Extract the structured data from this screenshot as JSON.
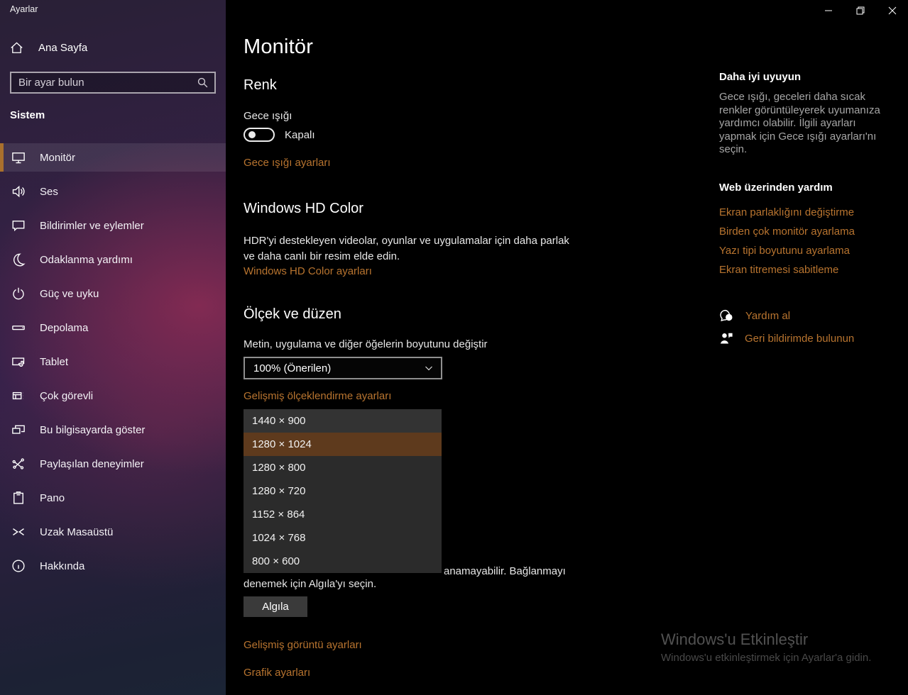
{
  "window": {
    "title": "Ayarlar",
    "controls": {
      "minimize": "minimize",
      "restore": "restore",
      "close": "close"
    }
  },
  "sidebar": {
    "home_label": "Ana Sayfa",
    "search_placeholder": "Bir ayar bulun",
    "section_label": "Sistem",
    "items": [
      {
        "icon": "monitor-icon",
        "label": "Monitör",
        "selected": true
      },
      {
        "icon": "speaker-icon",
        "label": "Ses",
        "selected": false
      },
      {
        "icon": "notifications-icon",
        "label": "Bildirimler ve eylemler",
        "selected": false
      },
      {
        "icon": "focus-moon-icon",
        "label": "Odaklanma yardımı",
        "selected": false
      },
      {
        "icon": "power-icon",
        "label": "Güç ve uyku",
        "selected": false
      },
      {
        "icon": "storage-icon",
        "label": "Depolama",
        "selected": false
      },
      {
        "icon": "tablet-icon",
        "label": "Tablet",
        "selected": false
      },
      {
        "icon": "multitask-icon",
        "label": "Çok görevli",
        "selected": false
      },
      {
        "icon": "project-icon",
        "label": "Bu bilgisayarda göster",
        "selected": false
      },
      {
        "icon": "shared-experiences-icon",
        "label": "Paylaşılan deneyimler",
        "selected": false
      },
      {
        "icon": "clipboard-icon",
        "label": "Pano",
        "selected": false
      },
      {
        "icon": "remote-desktop-icon",
        "label": "Uzak Masaüstü",
        "selected": false
      },
      {
        "icon": "info-icon",
        "label": "Hakkında",
        "selected": false
      }
    ]
  },
  "main": {
    "page_title": "Monitör",
    "color_section": {
      "heading": "Renk",
      "night_light_label": "Gece ışığı",
      "toggle_state": "Kapalı",
      "link": "Gece ışığı ayarları"
    },
    "hd_color_section": {
      "heading": "Windows HD Color",
      "description": "HDR'yi destekleyen videolar, oyunlar ve uygulamalar için daha parlak ve daha canlı bir resim elde edin.",
      "link": "Windows HD Color ayarları"
    },
    "scale_section": {
      "heading": "Ölçek ve düzen",
      "label": "Metin, uygulama ve diğer öğelerin boyutunu değiştir",
      "selected_value": "100% (Önerilen)",
      "link": "Gelişmiş ölçeklendirme ayarları"
    },
    "resolution_dropdown": {
      "options": [
        "1440 × 900",
        "1280 × 1024",
        "1280 × 800",
        "1280 × 720",
        "1152 × 864",
        "1024 × 768",
        "800 × 600"
      ],
      "selected": "1280 × 1024",
      "selected_index": 1
    },
    "detect_section": {
      "text_fragment_line1": "anamayabilir. Bağlanmayı",
      "text_line2": "denemek için Algıla'yı seçin.",
      "button_label": "Algıla"
    },
    "bottom_links": {
      "advanced_display": "Gelişmiş görüntü ayarları",
      "graphics": "Grafik ayarları"
    }
  },
  "right_column": {
    "sleep_tip": {
      "heading": "Daha iyi uyuyun",
      "text": "Gece ışığı, geceleri daha sıcak renkler görüntüleyerek uyumanıza yardımcı olabilir. İlgili ayarları yapmak için Gece ışığı ayarları'nı seçin."
    },
    "web_help": {
      "heading": "Web üzerinden yardım",
      "links": [
        "Ekran parlaklığını değiştirme",
        "Birden çok monitör ayarlama",
        "Yazı tipi boyutunu ayarlama",
        "Ekran titremesi sabitleme"
      ]
    },
    "support": [
      {
        "icon": "get-help-icon",
        "label": "Yardım al"
      },
      {
        "icon": "feedback-icon",
        "label": "Geri bildirimde bulunun"
      }
    ]
  },
  "watermark": {
    "line1": "Windows'u Etkinleştir",
    "line2": "Windows'u etkinleştirmek için Ayarlar'a gidin."
  },
  "colors": {
    "accent_link": "#b8742f",
    "accent_selection_bar": "#a9702d",
    "dropdown_highlight": "#5e3a1d",
    "main_background": "#000000",
    "dropdown_background": "#2b2b2b"
  }
}
